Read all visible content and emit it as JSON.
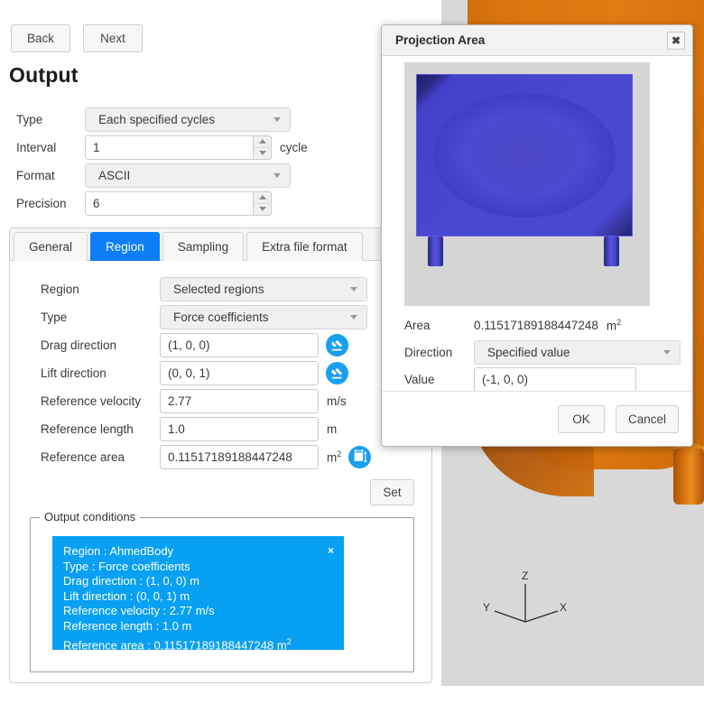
{
  "nav": {
    "back_label": "Back",
    "next_label": "Next"
  },
  "page_title": "Output",
  "top_form": {
    "type": {
      "label": "Type",
      "value": "Each specified cycles"
    },
    "interval": {
      "label": "Interval",
      "value": "1",
      "unit": "cycle"
    },
    "format": {
      "label": "Format",
      "value": "ASCII"
    },
    "precision": {
      "label": "Precision",
      "value": "6"
    }
  },
  "tabs": [
    {
      "label": "General",
      "active": false
    },
    {
      "label": "Region",
      "active": true
    },
    {
      "label": "Sampling",
      "active": false
    },
    {
      "label": "Extra file format",
      "active": false
    }
  ],
  "region_form": {
    "region": {
      "label": "Region",
      "value": "Selected regions"
    },
    "type": {
      "label": "Type",
      "value": "Force coefficients"
    },
    "drag_direction": {
      "label": "Drag direction",
      "value": "(1, 0, 0)"
    },
    "lift_direction": {
      "label": "Lift direction",
      "value": "(0, 0, 1)"
    },
    "reference_velocity": {
      "label": "Reference velocity",
      "value": "2.77",
      "unit": "m/s"
    },
    "reference_length": {
      "label": "Reference length",
      "value": "1.0",
      "unit": "m"
    },
    "reference_area": {
      "label": "Reference area",
      "value": "0.11517189188447248",
      "unit_base": "m",
      "unit_sup": "2"
    },
    "set_label": "Set"
  },
  "output_conditions": {
    "legend": "Output conditions",
    "close_label": "×",
    "lines": [
      "Region : AhmedBody",
      "Type : Force coefficients",
      "Drag direction : (1, 0, 0) m",
      "Lift direction : (0, 0, 1) m",
      "Reference velocity : 2.77 m/s",
      "Reference length : 1.0 m"
    ],
    "area_line_prefix": "Reference area : 0.11517189188447248 m",
    "area_line_sup": "2"
  },
  "dialog": {
    "title": "Projection Area",
    "close_label": "✖",
    "area": {
      "label": "Area",
      "value": "0.11517189188447248",
      "unit_base": "m",
      "unit_sup": "2"
    },
    "direction": {
      "label": "Direction",
      "value": "Specified value"
    },
    "value": {
      "label": "Value",
      "value": "(-1, 0, 0)"
    },
    "ok_label": "OK",
    "cancel_label": "Cancel"
  },
  "viewport": {
    "axis": {
      "x": "X",
      "y": "Y",
      "z": "Z"
    }
  },
  "colors": {
    "accent_blue": "#0d7ef7",
    "condition_blue": "#08a0f2",
    "icon_blue": "#18a0f0",
    "body_orange": "#d9760d",
    "projection_blue": "#4a48d0"
  }
}
